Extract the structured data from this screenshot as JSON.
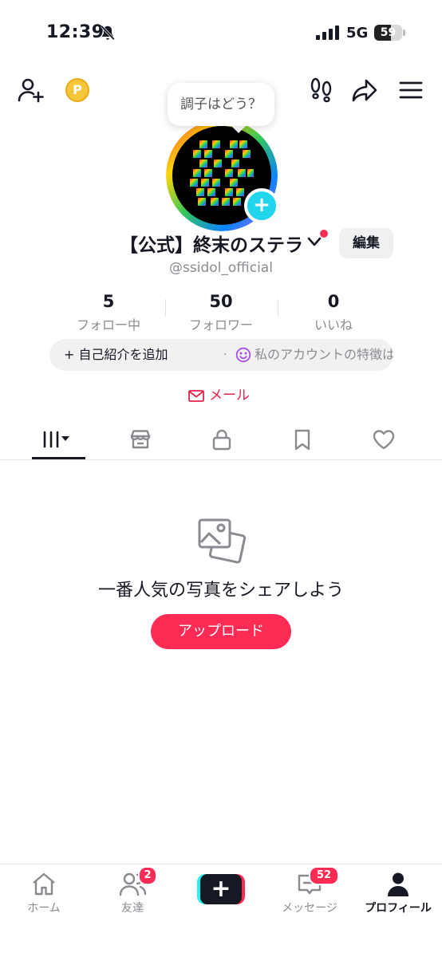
{
  "status_bar": {
    "time": "12:39",
    "network": "5G",
    "battery": "59",
    "battery_level": 0.59
  },
  "top_bar": {
    "coin_symbol": "P",
    "icons": [
      "add-friend-icon",
      "coin-icon",
      "footprint-icon",
      "share-icon",
      "menu-icon"
    ]
  },
  "mood_bubble": {
    "text": "調子はどう？"
  },
  "profile": {
    "display_name": "【公式】終末のステラ",
    "edit_label": "編集",
    "username": "@ssidol_official",
    "avatar_add_symbol": "+"
  },
  "stats": [
    {
      "value": "5",
      "label": "フォロー中"
    },
    {
      "value": "50",
      "label": "フォロワー"
    },
    {
      "value": "0",
      "label": "いいね"
    }
  ],
  "bio": {
    "add_label": "+ 自己紹介を追加",
    "separator": "·",
    "hint": "私のアカウントの特徴は..."
  },
  "email": {
    "label": "メール"
  },
  "tabs": [
    {
      "name": "videos",
      "icon": "grid-icon",
      "selected": true
    },
    {
      "name": "shop",
      "icon": "shop-icon",
      "selected": false
    },
    {
      "name": "private",
      "icon": "lock-icon",
      "selected": false
    },
    {
      "name": "saved",
      "icon": "bookmark-icon",
      "selected": false
    },
    {
      "name": "liked",
      "icon": "heart-icon",
      "selected": false
    }
  ],
  "empty_state": {
    "title": "一番人気の写真をシェアしよう",
    "button_label": "アップロード"
  },
  "bottom_nav": {
    "home": "ホーム",
    "friends": "友達",
    "friends_badge": "2",
    "create_symbol": "+",
    "inbox": "メッセージ",
    "inbox_badge": "52",
    "profile": "プロフィール"
  },
  "colors": {
    "accent": "#fe2c55",
    "cyan": "#25f4ee",
    "avatar_plus": "#20d5ec",
    "text": "#161823",
    "muted": "#8a8b91"
  }
}
